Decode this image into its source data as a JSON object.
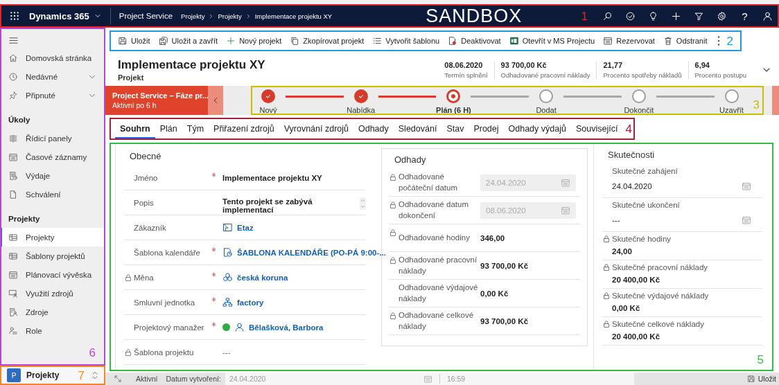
{
  "top_bar": {
    "app_name": "Dynamics 365",
    "area": "Project Service",
    "breadcrumb": [
      "Projekty",
      "Projekty",
      "Implementace projektu XY"
    ],
    "environment": "SANDBOX",
    "help": "?",
    "annotation": {
      "label": "1",
      "color": "#e3242b"
    }
  },
  "sidebar": {
    "pinned_items": [
      {
        "label": "Domovská stránka",
        "kind": "link"
      },
      {
        "label": "Nedávné",
        "kind": "group",
        "expanded": false
      },
      {
        "label": "Připnuté",
        "kind": "group",
        "expanded": false
      }
    ],
    "sections": [
      {
        "title": "Úkoly",
        "items": [
          {
            "label": "Řídicí panely",
            "selected": false
          },
          {
            "label": "Časové záznamy",
            "selected": false
          },
          {
            "label": "Výdaje",
            "selected": false
          },
          {
            "label": "Schválení",
            "selected": false
          }
        ]
      },
      {
        "title": "Projekty",
        "items": [
          {
            "label": "Projekty",
            "selected": true
          },
          {
            "label": "Šablony projektů",
            "selected": false
          },
          {
            "label": "Plánovací vývěska",
            "selected": false
          },
          {
            "label": "Využití zdrojů",
            "selected": false
          },
          {
            "label": "Zdroje",
            "selected": false
          },
          {
            "label": "Role",
            "selected": false
          }
        ]
      }
    ],
    "annotation": {
      "label": "6",
      "color": "#b847d6"
    }
  },
  "area_switcher": {
    "badge": "P",
    "label": "Projekty",
    "annotation": {
      "label": "7",
      "color": "#f0882e"
    }
  },
  "command_bar": {
    "commands": [
      {
        "label": "Uložit"
      },
      {
        "label": "Uložit a zavřít"
      },
      {
        "label": "Nový projekt"
      },
      {
        "label": "Zkopírovat projekt"
      },
      {
        "label": "Vytvořit šablonu"
      },
      {
        "label": "Deaktivovat"
      },
      {
        "label": "Otevřít v MS Projectu"
      },
      {
        "label": "Rezervovat"
      },
      {
        "label": "Odstranit"
      }
    ],
    "annotation": {
      "label": "2",
      "color": "#1e9be0"
    }
  },
  "header": {
    "title": "Implementace projektu XY",
    "entity": "Projekt",
    "fields": [
      {
        "value": "08.06.2020",
        "label": "Termín splnění"
      },
      {
        "value": "93 700,00 Kč",
        "label": "Odhadované pracovní náklady"
      },
      {
        "value": "21,77",
        "label": "Procento spotřeby nákladů"
      },
      {
        "value": "6,94",
        "label": "Procento postupu"
      }
    ]
  },
  "process_bar": {
    "stage_name": "Project Service – Fáze pr...",
    "active_for": "Aktivní po 6 h",
    "stages": [
      {
        "label": "Nový",
        "completed": true,
        "selected": false
      },
      {
        "label": "Nabídka",
        "completed": true,
        "selected": false
      },
      {
        "label": "Plán  (6 H)",
        "completed": false,
        "selected": true
      },
      {
        "label": "Dodat",
        "completed": false,
        "selected": false
      },
      {
        "label": "Dokončit",
        "completed": false,
        "selected": false
      },
      {
        "label": "Uzavřít",
        "completed": false,
        "selected": false
      }
    ],
    "annotation": {
      "label": "3",
      "color": "#cbbd00"
    }
  },
  "tabs": {
    "items": [
      {
        "label": "Souhrn",
        "selected": true
      },
      {
        "label": "Plán",
        "selected": false
      },
      {
        "label": "Tým",
        "selected": false
      },
      {
        "label": "Přiřazení zdrojů",
        "selected": false
      },
      {
        "label": "Vyrovnání zdrojů",
        "selected": false
      },
      {
        "label": "Odhady",
        "selected": false
      },
      {
        "label": "Sledování",
        "selected": false
      },
      {
        "label": "Stav",
        "selected": false
      },
      {
        "label": "Prodej",
        "selected": false
      },
      {
        "label": "Odhady výdajů",
        "selected": false
      },
      {
        "label": "Související",
        "selected": false
      }
    ],
    "annotation": {
      "label": "4",
      "color": "#a3203f"
    }
  },
  "form": {
    "annotation": {
      "label": "5",
      "color": "#2fbf45"
    },
    "general": {
      "title": "Obecné",
      "fields": [
        {
          "label": "Jméno",
          "required": true,
          "locked": false,
          "kind": "text",
          "value": "Implementace projektu XY"
        },
        {
          "label": "Popis",
          "required": false,
          "locked": false,
          "kind": "multiline",
          "value": "Tento projekt se zabývá implementací"
        },
        {
          "label": "Zákazník",
          "required": false,
          "locked": false,
          "kind": "lookup",
          "value": "Etaz"
        },
        {
          "label": "Šablona kalendáře",
          "required": true,
          "locked": false,
          "kind": "lookup",
          "value": "ŠABLONA KALENDÁŘE (PO-PÁ 9:00-..."
        },
        {
          "label": "Měna",
          "required": true,
          "locked": true,
          "kind": "lookup",
          "value": "česká koruna"
        },
        {
          "label": "Smluvní jednotka",
          "required": true,
          "locked": false,
          "kind": "lookup",
          "value": "factory"
        },
        {
          "label": "Projektový manažer",
          "required": true,
          "locked": false,
          "kind": "lookup",
          "value": "Bělašková, Barbora",
          "online": true
        },
        {
          "label": "Šablona projektu",
          "required": false,
          "locked": true,
          "kind": "empty",
          "value": "---"
        }
      ]
    },
    "estimates": {
      "title": "Odhady",
      "fields": [
        {
          "label": "Odhadované počáteční datum",
          "locked": true,
          "kind": "date",
          "disabled": true,
          "value": "24.04.2020"
        },
        {
          "label": "Odhadované datum dokončení",
          "locked": true,
          "kind": "date",
          "disabled": true,
          "value": "08.06.2020"
        },
        {
          "label": "Odhadované hodiny",
          "locked": true,
          "kind": "number",
          "value": "346,00"
        },
        {
          "label": "Odhadované pracovní náklady",
          "locked": true,
          "kind": "number",
          "value": "93 700,00 Kč"
        },
        {
          "label": "Odhadované výdajové náklady",
          "locked": false,
          "kind": "number",
          "value": "0,00 Kč"
        },
        {
          "label": "Odhadované celkové náklady",
          "locked": true,
          "kind": "number",
          "value": "93 700,00 Kč"
        }
      ]
    },
    "actuals": {
      "title": "Skutečnosti",
      "fields": [
        {
          "label": "Skutečné zahájení",
          "locked": false,
          "kind": "date",
          "value": "24.04.2020"
        },
        {
          "label": "Skutečné ukončení",
          "locked": false,
          "kind": "date",
          "value": "---"
        },
        {
          "label": "Skutečné hodiny",
          "locked": true,
          "kind": "number",
          "value": "24,00"
        },
        {
          "label": "Skutečné pracovní náklady",
          "locked": true,
          "kind": "number",
          "value": "20 400,00 Kč"
        },
        {
          "label": "Skutečné výdajové náklady",
          "locked": true,
          "kind": "number",
          "value": "0,00 Kč"
        },
        {
          "label": "Skutečné celkové náklady",
          "locked": true,
          "kind": "number",
          "value": "20 400,00 Kč"
        }
      ]
    }
  },
  "status_bar": {
    "status": "Aktivní",
    "created_label": "Datum vytvoření:",
    "created_date": "24.04.2020",
    "created_time": "16:59",
    "save": "Uložit"
  }
}
